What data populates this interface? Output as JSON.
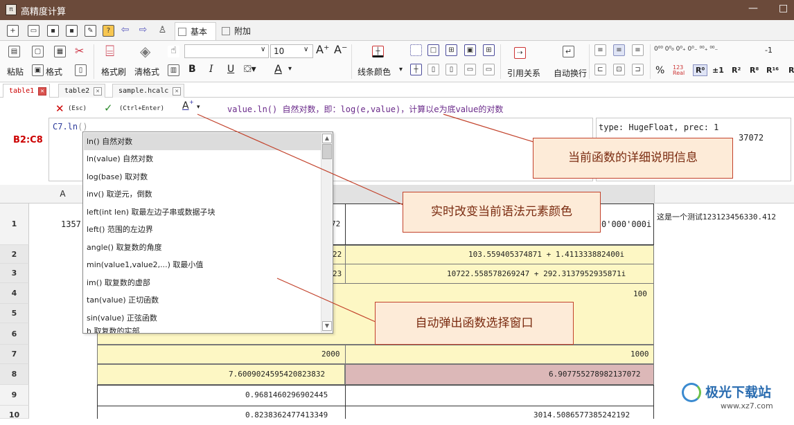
{
  "app": {
    "title": "高精度计算",
    "icon_label": "π"
  },
  "window_controls": {
    "minimize": "—",
    "maximize": "□"
  },
  "ribbon_tabs": [
    {
      "label": "基本"
    },
    {
      "label": "附加"
    }
  ],
  "toolbar": {
    "paste": "粘贴",
    "format": "格式",
    "format_brush": "格式刷",
    "clear_format": "清格式",
    "bold": "B",
    "italic": "I",
    "underline": "U",
    "font_color": "A",
    "font_size": "10",
    "font_grow": "A⁺",
    "font_shrink": "A⁻",
    "line_color": "线条颜色",
    "reference": "引用关系",
    "wrap": "自动换行",
    "percent": "%",
    "neg_one": "-1",
    "sci_buttons": [
      "R⁰",
      "±1",
      "R²",
      "R⁸",
      "R¹⁶",
      "R"
    ]
  },
  "doc_tabs": [
    {
      "label": "table1"
    },
    {
      "label": "table2"
    },
    {
      "label": "sample.hcalc"
    }
  ],
  "formula_bar": {
    "cancel": "(Esc)",
    "confirm": "(Ctrl+Enter)",
    "color_btn": "A",
    "help_fn": "value.ln()",
    "help_a": "自然对数，即：",
    "help_fn2": "log(e,value)",
    "help_b": "，计算以e为底value的对数",
    "range": "B2:C8",
    "input_prefix": "C7.ln",
    "input_suffix": "()",
    "type_info": "type: HugeFloat, prec: 1",
    "type_value": "37072"
  },
  "function_popup": {
    "items": [
      "ln() 自然对数",
      "ln(value) 自然对数",
      "log(base) 取对数",
      "inv() 取逆元，倒数",
      "left(int len) 取最左边子串或数据子块",
      "left() 范围的左边界",
      "angle() 取复数的角度",
      "min(value1,value2,...) 取最小值",
      "im() 取复数的虚部",
      "tan(value) 正切函数",
      "sin(value) 正弦函数",
      "h 取复数的实部"
    ]
  },
  "grid": {
    "col_a": "A",
    "rows": [
      "1",
      "2",
      "3",
      "4",
      "5",
      "6",
      "7",
      "8",
      "9",
      "10"
    ],
    "a1": "1357",
    "b1": "72",
    "c1": "0'000'000i",
    "d1": "这是一个测试123123456330.412",
    "b2": "22",
    "c2": "103.559405374871 + 1.411333882400i",
    "b3": "23",
    "c3": "10722.558578269247 + 292.3137952935871i",
    "c4": "100",
    "b7": "2000",
    "c7": "1000",
    "b8": "7.6009024595420823832",
    "c8": "6.907755278982137072",
    "b9": "0.9681460296902445",
    "b10": "0.8238362477413349",
    "c10": "3014.5086577385242192"
  },
  "callouts": {
    "detail": "当前函数的详细说明信息",
    "color": "实时改变当前语法元素颜色",
    "popup": "自动弹出函数选择窗口"
  },
  "watermark": {
    "name": "极光下载站",
    "url": "www.xz7.com"
  },
  "colors": {
    "title_bar": "#6b4a3a",
    "highlight_yellow": "#fdf7c4",
    "highlight_pink": "#dcb8b8",
    "callout_border": "#c2412a",
    "range_red": "#cc0000"
  }
}
